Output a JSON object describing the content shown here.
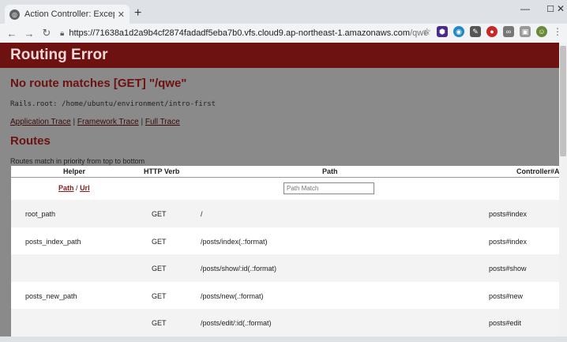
{
  "browser": {
    "tab_title": "Action Controller: Exception ca",
    "url_main": "https://71638a1d2a9b4cf2874fadadf5eba7b0.vfs.cloud9.ap-northeast-1.amazonaws.com",
    "url_path": "/qwe",
    "new_tab_label": "+",
    "window_controls": [
      "—",
      "☐",
      "✕"
    ]
  },
  "page": {
    "header_title": "Routing Error",
    "error_title": "No route matches [GET] \"/qwe\"",
    "rails_root": "Rails.root: /home/ubuntu/environment/intro-first",
    "traces": {
      "application": "Application Trace",
      "framework": "Framework Trace",
      "full": "Full Trace",
      "separator": "|"
    },
    "routes_title": "Routes",
    "priority_note": "Routes match in priority from top to bottom"
  },
  "table": {
    "headers": {
      "helper": "Helper",
      "verb": "HTTP Verb",
      "path": "Path",
      "controller": "Controller#A"
    },
    "filter": {
      "path_link": "Path",
      "sep": "/",
      "url_link": "Url",
      "path_match_placeholder": "Path Match"
    },
    "rows": [
      {
        "helper": "root_path",
        "verb": "GET",
        "path": "/",
        "controller": "posts#index"
      },
      {
        "helper": "posts_index_path",
        "verb": "GET",
        "path": "/posts/index(.:format)",
        "controller": "posts#index"
      },
      {
        "helper": "",
        "verb": "GET",
        "path": "/posts/show/:id(.:format)",
        "controller": "posts#show"
      },
      {
        "helper": "posts_new_path",
        "verb": "GET",
        "path": "/posts/new(.:format)",
        "controller": "posts#new"
      },
      {
        "helper": "",
        "verb": "GET",
        "path": "/posts/edit/:id(.:format)",
        "controller": "posts#edit"
      }
    ]
  },
  "colors": {
    "header_bg": "#6d1111",
    "title_red": "#6d1111",
    "overlay_gray": "#8a8a8a"
  }
}
